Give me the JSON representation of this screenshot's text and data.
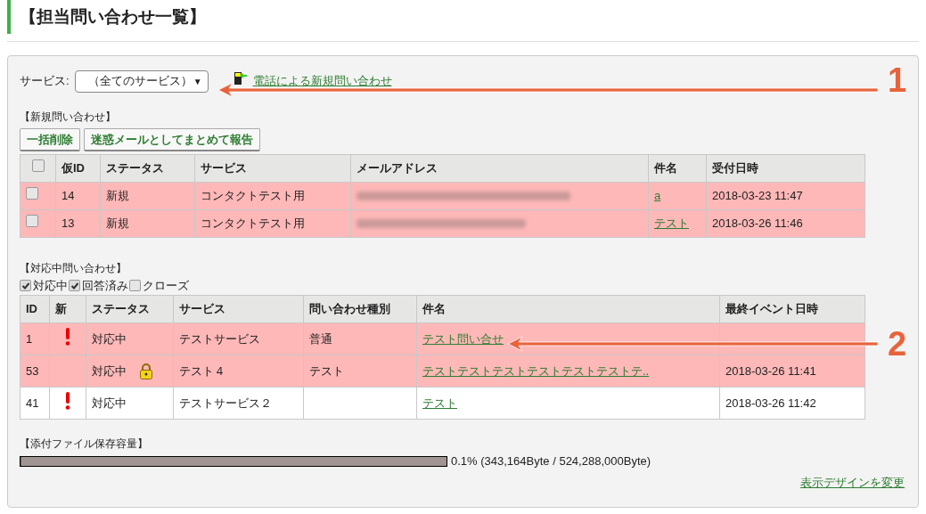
{
  "page_title": "【担当問い合わせ一覧】",
  "service_filter": {
    "label": "サービス:",
    "value": "（全てのサービス）",
    "caret": "▼"
  },
  "phone_link": "電話による新規問い合わせ",
  "new_inquiries": {
    "heading": "【新規問い合わせ】",
    "buttons": [
      "一括削除",
      "迷惑メールとしてまとめて報告"
    ],
    "columns": [
      "仮ID",
      "ステータス",
      "サービス",
      "メールアドレス",
      "件名",
      "受付日時"
    ],
    "header_checked": false,
    "rows": [
      {
        "checked": false,
        "id": "14",
        "status": "新規",
        "service": "コンタクトテスト用",
        "subject": "a",
        "received": "2018-03-23 11:47"
      },
      {
        "checked": false,
        "id": "13",
        "status": "新規",
        "service": "コンタクトテスト用",
        "subject": "テスト",
        "received": "2018-03-26 11:46"
      }
    ]
  },
  "open_inquiries": {
    "heading": "【対応中問い合わせ】",
    "filters": [
      {
        "label": "対応中",
        "checked": true
      },
      {
        "label": "回答済み",
        "checked": true
      },
      {
        "label": "クローズ",
        "checked": false
      }
    ],
    "columns": [
      "ID",
      "新",
      "ステータス",
      "サービス",
      "問い合わせ種別",
      "件名",
      "最終イベント日時"
    ],
    "rows": [
      {
        "highlighted": true,
        "id": "1",
        "new": true,
        "status": "対応中",
        "locked": false,
        "service": "テストサービス",
        "type": "普通",
        "subject": "テスト問い合せ"
      },
      {
        "highlighted": true,
        "id": "53",
        "new": false,
        "status": "対応中",
        "locked": true,
        "service": "テスト４",
        "type": "テスト",
        "subject": "テストテストテストテストテストテストテ..",
        "last_event": "2018-03-26 11:41"
      },
      {
        "highlighted": false,
        "id": "41",
        "new": true,
        "status": "対応中",
        "locked": false,
        "service": "テストサービス２",
        "subject": "テスト",
        "last_event": "2018-03-26 11:42"
      }
    ]
  },
  "storage": {
    "heading": "【添付ファイル保存容量】",
    "level": 0.001,
    "reading": "0.1% (343,164Byte / 524,288,000Byte)"
  },
  "design_link": "表示デザインを変更",
  "annotations": [
    {
      "label": "1"
    },
    {
      "label": "2"
    }
  ]
}
